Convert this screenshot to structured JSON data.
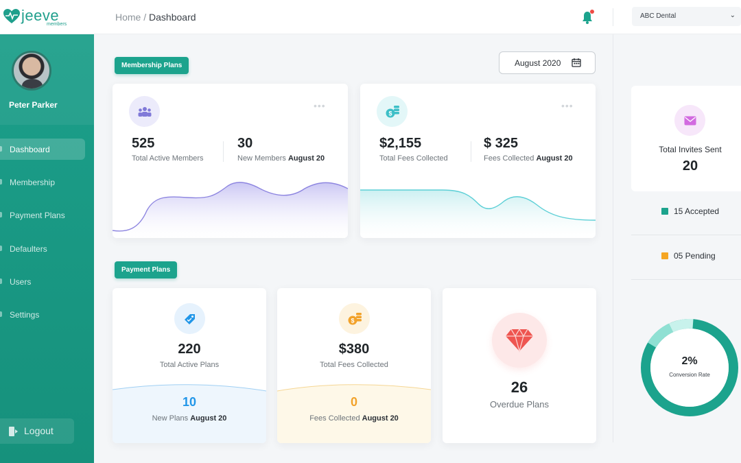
{
  "brand": {
    "logo_text": "jeeve",
    "logo_sub": "members",
    "accent": "#1ca38d"
  },
  "header": {
    "breadcrumb_home": "Home",
    "breadcrumb_sep": "/",
    "breadcrumb_current": "Dashboard",
    "notification_icon": "bell-icon",
    "org_selected": "ABC Dental"
  },
  "sidebar": {
    "user_name": "Peter Parker",
    "items": [
      {
        "label": "Dashboard",
        "active": true
      },
      {
        "label": "Membership"
      },
      {
        "label": "Payment Plans"
      },
      {
        "label": "Defaulters"
      },
      {
        "label": "Users"
      },
      {
        "label": "Settings"
      }
    ],
    "logout_label": "Logout"
  },
  "membership": {
    "section_label": "Membership Plans",
    "date_filter": "August 2020",
    "members_card": {
      "icon": "group-icon",
      "total_value": "525",
      "total_label": "Total Active Members",
      "new_value": "30",
      "new_label_prefix": "New Members",
      "new_label_period": "August 20",
      "chart_color": "#8d85e0"
    },
    "fees_card": {
      "icon": "coins-icon",
      "total_value": "$2,155",
      "total_label": "Total Fees Collected",
      "period_value": "$ 325",
      "period_label_prefix": "Fees Collected",
      "period_label_period": "August 20",
      "chart_color": "#5ccfd6"
    }
  },
  "payment_plans": {
    "section_label": "Payment Plans",
    "plans_card": {
      "icon": "tag-icon",
      "total_value": "220",
      "total_label": "Total Active Plans",
      "new_value": "10",
      "new_label_prefix": "New Plans",
      "new_label_period": "August 20",
      "accent": "#2196e8"
    },
    "fees_card": {
      "icon": "coins-icon",
      "total_value": "$380",
      "total_label": "Total Fees Collected",
      "period_value": "0",
      "period_label_prefix": "Fees Collected",
      "period_label_period": "August 20",
      "accent": "#f2a22a"
    },
    "overdue_card": {
      "icon": "diamond-icon",
      "value": "26",
      "label": "Overdue Plans",
      "accent": "#ee5550"
    }
  },
  "invites": {
    "icon": "mail-icon",
    "label": "Total Invites Sent",
    "value": "20",
    "accepted_label": "15 Accepted",
    "pending_label": "05 Pending",
    "accepted_color": "#1ca38d",
    "pending_color": "#f5a623",
    "conversion_value": "2%",
    "conversion_label": "Conversion Rate"
  }
}
